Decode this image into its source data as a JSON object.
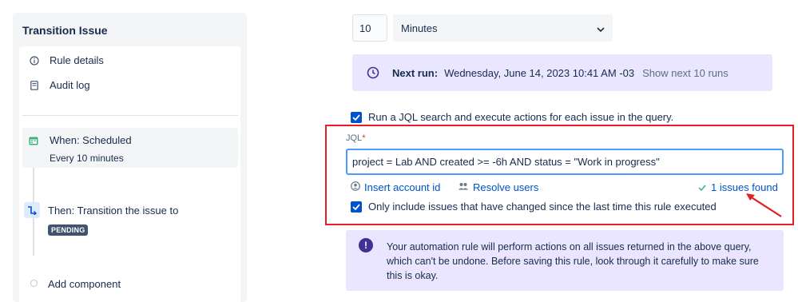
{
  "sidebar": {
    "title": "Transition Issue",
    "links": [
      {
        "label": "Rule details",
        "icon": "info-icon"
      },
      {
        "label": "Audit log",
        "icon": "document-icon"
      }
    ],
    "trigger": {
      "title": "When: Scheduled",
      "subtitle": "Every 10 minutes",
      "icon": "calendar-icon",
      "color": "#36b37e"
    },
    "action": {
      "title": "Then: Transition the issue to",
      "status": "PENDING",
      "icon": "transition-icon",
      "color": "#0052cc"
    },
    "add_component": "Add component"
  },
  "schedule": {
    "interval_value": "10",
    "unit": "Minutes"
  },
  "next_run": {
    "label": "Next run:",
    "datetime": "Wednesday, June 14, 2023 10:41 AM -03",
    "show_more": "Show next 10 runs"
  },
  "jql_option": {
    "checked": true,
    "label": "Run a JQL search and execute actions for each issue in the query."
  },
  "jql": {
    "label": "JQL",
    "required_mark": "*",
    "value": "project = Lab AND created >= -6h AND status = \"Work in progress\"",
    "insert_account": "Insert account id",
    "resolve_users": "Resolve users",
    "issues_found": "1 issues found"
  },
  "changed_option": {
    "checked": true,
    "label": "Only include issues that have changed since the last time this rule executed"
  },
  "warning": {
    "text": "Your automation rule will perform actions on all issues returned in the above query, which can't be undone. Before saving this rule, look through it carefully to make sure this is okay."
  },
  "colors": {
    "accent": "#0052cc",
    "highlight_box": "#e31e24",
    "info_bg": "#eae6ff"
  }
}
